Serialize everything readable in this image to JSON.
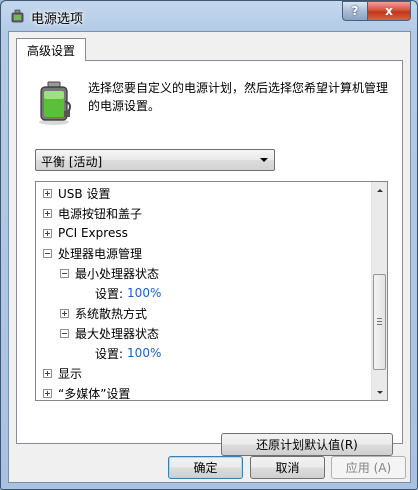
{
  "window": {
    "title": "电源选项"
  },
  "title_buttons": {
    "help": "?",
    "close": "x"
  },
  "tab": {
    "label": "高级设置"
  },
  "description": "选择您要自定义的电源计划，然后选择您希望计算机管理的电源设置。",
  "plan_select": {
    "value": "平衡 [活动]"
  },
  "tree": [
    {
      "label": "USB 设置",
      "expander": "plus",
      "level": 0
    },
    {
      "label": "电源按钮和盖子",
      "expander": "plus",
      "level": 0
    },
    {
      "label": "PCI Express",
      "expander": "plus",
      "level": 0
    },
    {
      "label": "处理器电源管理",
      "expander": "minus",
      "level": 0
    },
    {
      "label": "最小处理器状态",
      "expander": "minus",
      "level": 1
    },
    {
      "setting_label": "设置:",
      "value": "100%",
      "level": 2
    },
    {
      "label": "系统散热方式",
      "expander": "plus",
      "level": 1
    },
    {
      "label": "最大处理器状态",
      "expander": "minus",
      "level": 1
    },
    {
      "setting_label": "设置:",
      "value": "100%",
      "level": 2
    },
    {
      "label": "显示",
      "expander": "plus",
      "level": 0
    },
    {
      "label": "“多媒体”设置",
      "expander": "plus",
      "level": 0
    }
  ],
  "buttons": {
    "restore": "还原计划默认值(R)",
    "ok": "确定",
    "cancel": "取消",
    "apply": "应用 (A)"
  },
  "colors": {
    "setting_value": "#1d5fc2",
    "close_button": "#c1361a"
  },
  "icons": {
    "title": "power-options-icon",
    "battery": "battery-plug-icon"
  }
}
